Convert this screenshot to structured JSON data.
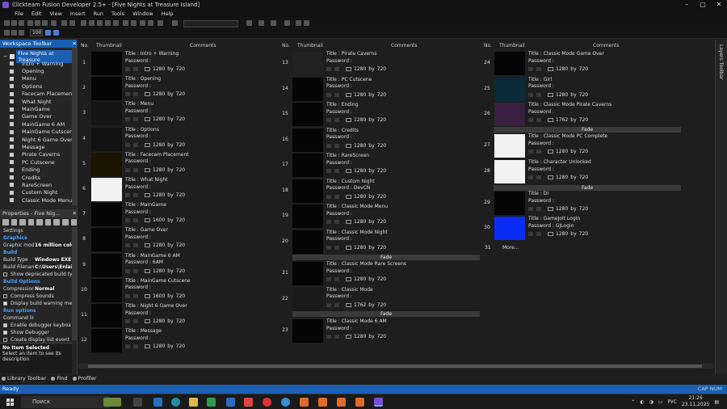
{
  "window": {
    "title": "Clickteam Fusion Developer 2.5+ - [Five Nights at Treasure Island]"
  },
  "menu": [
    "File",
    "Edit",
    "View",
    "Insert",
    "Run",
    "Tools",
    "Window",
    "Help"
  ],
  "toolbar": {
    "zoom": "100"
  },
  "workspace": {
    "title": "Workspace Toolbar",
    "root": "Five Nights at Treasure",
    "items": [
      "Intro + Warning",
      "Opening",
      "Menu",
      "Options",
      "Facecam Placement",
      "What Night",
      "MainGame",
      "Game Over",
      "MainGame 6 AM",
      "MainGame Cutscene",
      "Night 6 Game Over",
      "Message",
      "Pirate Caverns",
      "PC Cutscene",
      "Ending",
      "Credits",
      "RareScreen",
      "Custom Night",
      "Classic Mode Menu"
    ]
  },
  "properties": {
    "title": "Properties - Five Nig...",
    "rows": [
      {
        "type": "plain",
        "key": "Settings"
      },
      {
        "type": "sec",
        "key": "Graphics"
      },
      {
        "type": "kv",
        "key": "Graphic mod",
        "value": "16 million colo"
      },
      {
        "type": "sec",
        "key": "Build"
      },
      {
        "type": "kv",
        "key": "Build Type",
        "value": "Windows EXE"
      },
      {
        "type": "kv",
        "key": "Build Filenam",
        "value": "C:\\Users\\Enlai"
      },
      {
        "type": "cb",
        "key": "Show deprecated build ty",
        "checked": false
      },
      {
        "type": "sec",
        "key": "Build Options"
      },
      {
        "type": "kv",
        "key": "Compression",
        "value": "Normal"
      },
      {
        "type": "cb",
        "key": "Compress Sounds",
        "checked": false
      },
      {
        "type": "cb",
        "key": "Display build warning me",
        "checked": true
      },
      {
        "type": "sec",
        "key": "Run options"
      },
      {
        "type": "kv",
        "key": "Command lin",
        "value": ""
      },
      {
        "type": "cb",
        "key": "Enable debugger keyboa",
        "checked": true
      },
      {
        "type": "cb",
        "key": "Show Debugger",
        "checked": true
      },
      {
        "type": "cb",
        "key": "Create display list event",
        "checked": false
      }
    ],
    "desc_title": "No Item Selected",
    "desc_text": "Select an item to see its description"
  },
  "bottom_tabs": [
    "Library Toolbar",
    "Find",
    "Profiler"
  ],
  "columns": {
    "no": "No.",
    "thumb": "Thumbnail",
    "comments": "Comments"
  },
  "labels": {
    "title": "Title : ",
    "password": "Password : ",
    "by": "by"
  },
  "frames": [
    {
      "no": "1",
      "title": "Intro + Warning",
      "w": "1280",
      "h": "720"
    },
    {
      "no": "2",
      "title": "Opening",
      "w": "1280",
      "h": "720"
    },
    {
      "no": "3",
      "title": "Menu",
      "w": "1280",
      "h": "720"
    },
    {
      "no": "4",
      "title": "Options",
      "w": "1280",
      "h": "720"
    },
    {
      "no": "5",
      "title": "Facecam Placement",
      "w": "1280",
      "h": "720"
    },
    {
      "no": "6",
      "title": "What Night",
      "w": "1280",
      "h": "720"
    },
    {
      "no": "7",
      "title": "MainGame",
      "w": "1600",
      "h": "720"
    },
    {
      "no": "8",
      "title": "Game Over",
      "w": "1280",
      "h": "720"
    },
    {
      "no": "9",
      "title": "MainGame 6 AM",
      "password": "6AM",
      "w": "1280",
      "h": "720"
    },
    {
      "no": "10",
      "title": "MainGame Cutscene",
      "w": "1600",
      "h": "720"
    },
    {
      "no": "11",
      "title": "Night 6 Game Over",
      "w": "1280",
      "h": "720"
    },
    {
      "no": "12",
      "title": "Message",
      "w": "1280",
      "h": "720"
    },
    {
      "no": "13",
      "title": "Pirate Caverns",
      "w": "1280",
      "h": "720"
    },
    {
      "no": "14",
      "title": "PC Cutscene",
      "w": "1280",
      "h": "720"
    },
    {
      "no": "15",
      "title": "Ending",
      "w": "1280",
      "h": "720"
    },
    {
      "no": "16",
      "title": "Credits",
      "w": "1280",
      "h": "720"
    },
    {
      "no": "17",
      "title": "RareScreen",
      "w": "1280",
      "h": "720"
    },
    {
      "no": "18",
      "title": "Custom Night",
      "password": "DevCN",
      "w": "1280",
      "h": "720"
    },
    {
      "no": "19",
      "title": "Classic Mode Menu",
      "w": "1280",
      "h": "720"
    },
    {
      "no": "20",
      "title": "Classic Mode Night",
      "w": "1280",
      "h": "720"
    },
    {
      "no": "21",
      "title": "Classic Mode Rare Screens",
      "w": "1280",
      "h": "720"
    },
    {
      "no": "22",
      "title": "Classic Mode",
      "w": "1762",
      "h": "720"
    },
    {
      "no": "23",
      "title": "Classic Mode 6 AM",
      "w": "1280",
      "h": "720"
    },
    {
      "no": "24",
      "title": "Classic Mode Game Over",
      "w": "1280",
      "h": "720"
    },
    {
      "no": "25",
      "title": "Girl",
      "w": "1280",
      "h": "720"
    },
    {
      "no": "26",
      "title": "Classic Mode Pirate Caverns",
      "w": "1762",
      "h": "720"
    },
    {
      "no": "27",
      "title": "Classic Mode PC Complete",
      "w": "1280",
      "h": "720"
    },
    {
      "no": "28",
      "title": "Character Unlocked",
      "w": "1280",
      "h": "720"
    },
    {
      "no": "29",
      "title": "DI",
      "w": "1280",
      "h": "720"
    },
    {
      "no": "30",
      "title": "GameJolt LogIn",
      "password": "GJLogin",
      "w": "1280",
      "h": "720"
    }
  ],
  "fade_label": "Fade",
  "more_label": "More...",
  "more_no": "31",
  "right_toolbar": "Layers Toolbar",
  "status": {
    "text": "Ready",
    "right": "CAP NUM"
  },
  "taskbar": {
    "search": "Поиск",
    "lang": "РУС",
    "time": "21:26",
    "date": "23.11.2025"
  },
  "colors": {
    "accent": "#1a5fb4",
    "bg": "#1e1e1e"
  }
}
